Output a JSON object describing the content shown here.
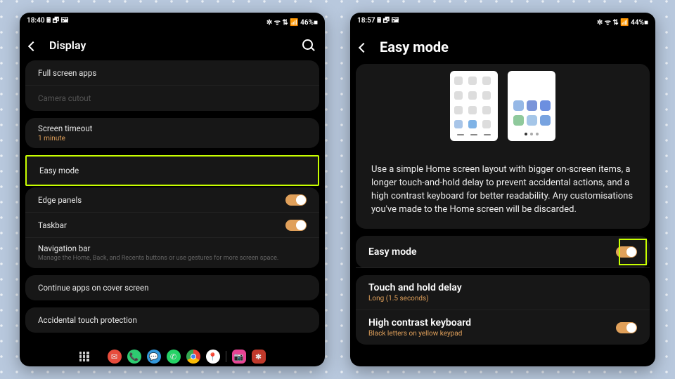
{
  "left": {
    "statusbar": {
      "time": "18:40",
      "left_icons": "🖩 🗗 🖼",
      "right_icons": "✲ ᯤ ⇅ 📶 46%■"
    },
    "header": {
      "title": "Display"
    },
    "rows": {
      "fullscreen": "Full screen apps",
      "camera_cutout": "Camera cutout",
      "screen_timeout": "Screen timeout",
      "screen_timeout_sub": "1 minute",
      "easy_mode": "Easy mode",
      "edge_panels": "Edge panels",
      "taskbar": "Taskbar",
      "nav_bar": "Navigation bar",
      "nav_bar_sub": "Manage the Home, Back, and Recents buttons or use gestures for more screen space.",
      "continue_apps": "Continue apps on cover screen",
      "accidental": "Accidental touch protection"
    }
  },
  "right": {
    "statusbar": {
      "time": "18:57",
      "left_icons": "🖩 🗗 🖼",
      "right_icons": "✲ ᯤ ⇅ 📶 44%■"
    },
    "header": {
      "title": "Easy mode"
    },
    "description": "Use a simple Home screen layout with bigger on-screen items, a longer touch-and-hold delay to prevent accidental actions, and a high contrast keyboard for better readability. Any customisations you've made to the Home screen will be discarded.",
    "rows": {
      "easy_mode": "Easy mode",
      "touch_hold": "Touch and hold delay",
      "touch_hold_sub": "Long (1.5 seconds)",
      "high_contrast": "High contrast keyboard",
      "high_contrast_sub": "Black letters on yellow keypad"
    }
  }
}
